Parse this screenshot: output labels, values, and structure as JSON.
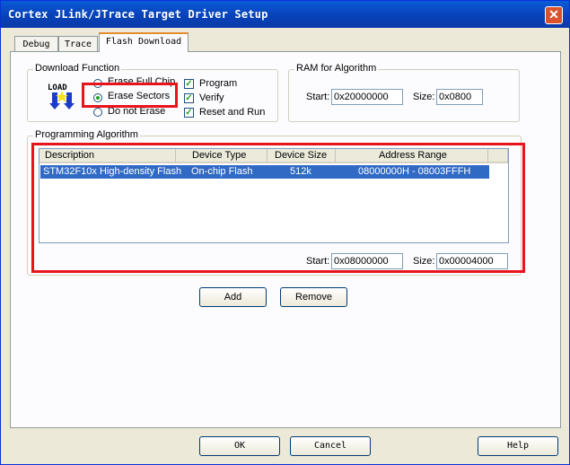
{
  "window": {
    "title": "Cortex JLink/JTrace Target Driver Setup"
  },
  "tabs": [
    {
      "label": "Debug"
    },
    {
      "label": "Trace"
    },
    {
      "label": "Flash Download"
    }
  ],
  "download_function": {
    "label": "Download Function",
    "icon_text": "LOAD",
    "radios": [
      {
        "label": "Erase Full Chip",
        "selected": false
      },
      {
        "label": "Erase Sectors",
        "selected": true
      },
      {
        "label": "Do not Erase",
        "selected": false
      }
    ],
    "checks": [
      {
        "label": "Program",
        "checked": true
      },
      {
        "label": "Verify",
        "checked": true
      },
      {
        "label": "Reset and Run",
        "checked": true
      }
    ]
  },
  "ram": {
    "label": "RAM for Algorithm",
    "start_label": "Start:",
    "start_value": "0x20000000",
    "size_label": "Size:",
    "size_value": "0x0800"
  },
  "programming": {
    "label": "Programming Algorithm",
    "columns": [
      "Description",
      "Device Type",
      "Device Size",
      "Address Range"
    ],
    "rows": [
      {
        "description": "STM32F10x High-density Flash",
        "device_type": "On-chip Flash",
        "device_size": "512k",
        "address_range": "08000000H - 08003FFFH"
      }
    ],
    "start_label": "Start:",
    "start_value": "0x08000000",
    "size_label": "Size:",
    "size_value": "0x00004000"
  },
  "buttons": {
    "add": "Add",
    "remove": "Remove",
    "ok": "OK",
    "cancel": "Cancel",
    "help": "Help"
  },
  "colors": {
    "highlight": "#e8141c",
    "selection": "#316ac5",
    "titlebar": "#0a5bd8"
  }
}
